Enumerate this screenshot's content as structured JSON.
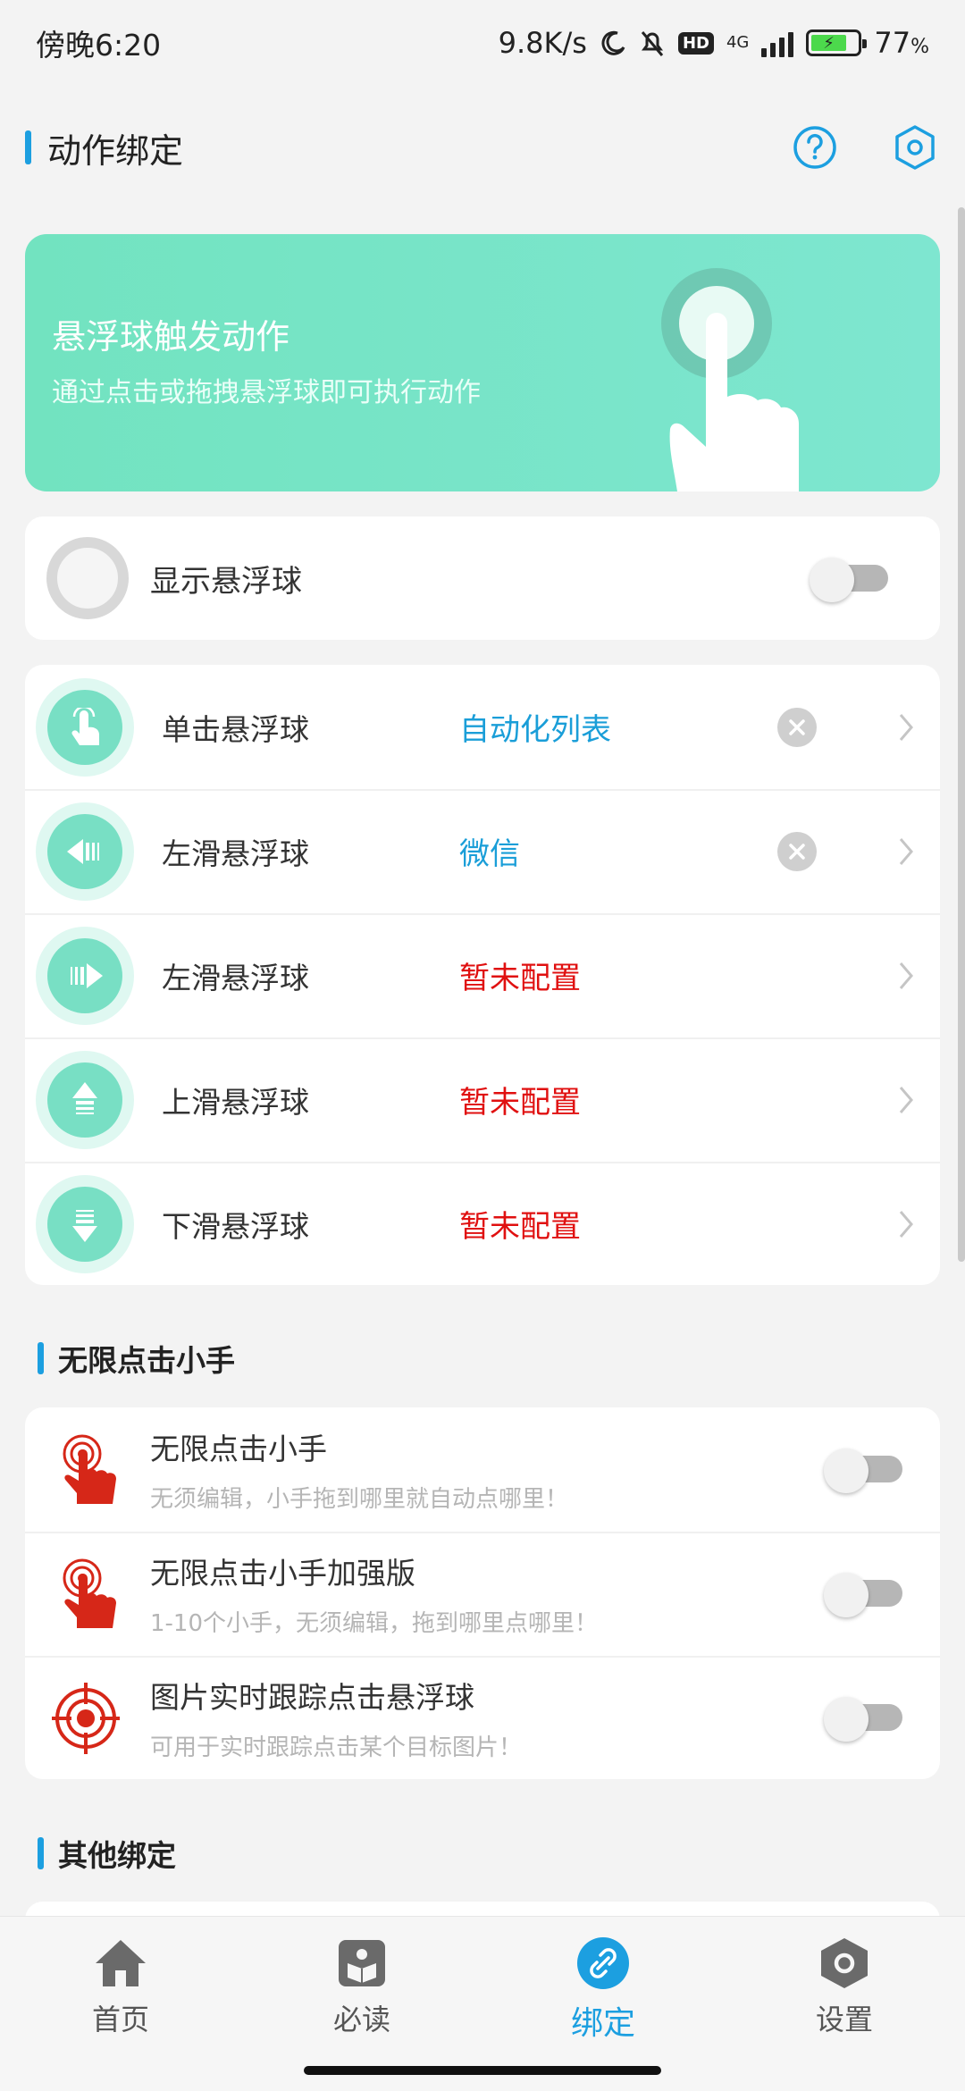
{
  "status_bar": {
    "time": "傍晚6:20",
    "net_speed": "9.8K/s",
    "hd": "HD",
    "network_type": "4G",
    "battery": "77",
    "battery_unit": "%"
  },
  "header": {
    "title": "动作绑定",
    "help_icon": "help-circle-icon",
    "settings_icon": "hexagon-gear-icon"
  },
  "banner": {
    "title": "悬浮球触发动作",
    "subtitle": "通过点击或拖拽悬浮球即可执行动作"
  },
  "show_ball": {
    "label": "显示悬浮球",
    "enabled": false
  },
  "actions": [
    {
      "label": "单击悬浮球",
      "value": "自动化列表",
      "configured": true,
      "icon": "tap-icon"
    },
    {
      "label": "左滑悬浮球",
      "value": "微信",
      "configured": true,
      "icon": "swipe-left-icon"
    },
    {
      "label": "左滑悬浮球",
      "value": "暂未配置",
      "configured": false,
      "icon": "swipe-right-icon"
    },
    {
      "label": "上滑悬浮球",
      "value": "暂未配置",
      "configured": false,
      "icon": "swipe-up-icon"
    },
    {
      "label": "下滑悬浮球",
      "value": "暂未配置",
      "configured": false,
      "icon": "swipe-down-icon"
    }
  ],
  "section_clicker": {
    "title": "无限点击小手",
    "items": [
      {
        "title": "无限点击小手",
        "desc": "无须编辑，小手拖到哪里就自动点哪里！",
        "icon": "clicker-hand-icon",
        "enabled": false
      },
      {
        "title": "无限点击小手加强版",
        "desc": "1-10个小手，无须编辑，拖到哪里点哪里！",
        "icon": "clicker-hand-icon",
        "enabled": false
      },
      {
        "title": "图片实时跟踪点击悬浮球",
        "desc": "可用于实时跟踪点击某个目标图片！",
        "icon": "target-icon",
        "enabled": false
      }
    ]
  },
  "section_other": {
    "title": "其他绑定"
  },
  "bottom_nav": [
    {
      "label": "首页",
      "icon": "home-icon",
      "active": false
    },
    {
      "label": "必读",
      "icon": "book-icon",
      "active": false
    },
    {
      "label": "绑定",
      "icon": "link-icon",
      "active": true
    },
    {
      "label": "设置",
      "icon": "hexagon-gear-icon",
      "active": false
    }
  ],
  "colors": {
    "accent": "#1c9fe0",
    "banner": "#76e4c8",
    "unconfigured": "#e01010",
    "configured": "#1a9ed8"
  }
}
